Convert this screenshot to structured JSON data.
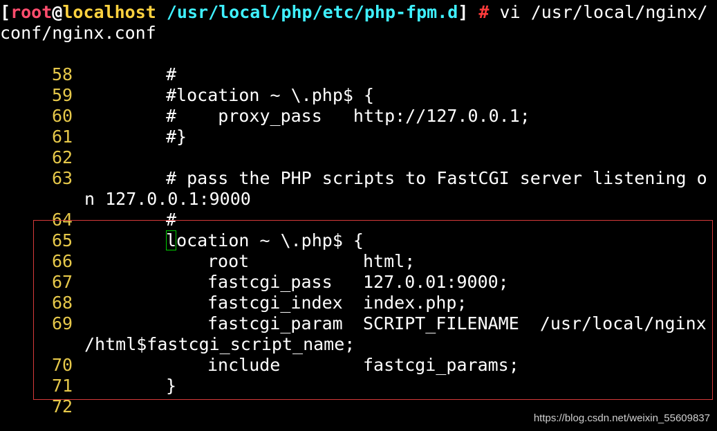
{
  "prompt": {
    "open_bracket": "[",
    "user": "root",
    "at": "@",
    "host": "localhost",
    "cwd": " /usr/local/php/etc/php-fpm.d",
    "close_bracket": "]",
    "hash": " #",
    "command_part1": " vi /usr/local/nginx/",
    "command_part2": "conf/nginx.conf"
  },
  "lines": [
    {
      "num": "58",
      "text": "#"
    },
    {
      "num": "59",
      "text": "#location ~ \\.php$ {"
    },
    {
      "num": "60",
      "text": "#    proxy_pass   http://127.0.0.1;"
    },
    {
      "num": "61",
      "text": "#}"
    },
    {
      "num": "62",
      "text": ""
    },
    {
      "num": "63",
      "text": "# pass the PHP scripts to FastCGI server listening o",
      "wrap": "n 127.0.0.1:9000"
    },
    {
      "num": "64",
      "text": "#"
    },
    {
      "num": "65",
      "cursor_char": "l",
      "text": "ocation ~ \\.php$ {"
    },
    {
      "num": "66",
      "key": "root",
      "value": "html;"
    },
    {
      "num": "67",
      "key": "fastcgi_pass",
      "value": "127.0.01:9000;"
    },
    {
      "num": "68",
      "key": "fastcgi_index",
      "value": "index.php;"
    },
    {
      "num": "69",
      "key": "fastcgi_param",
      "value": "SCRIPT_FILENAME  /usr/local/nginx",
      "wrap": "/html$fastcgi_script_name;"
    },
    {
      "num": "70",
      "key": "include",
      "value": "fastcgi_params;"
    },
    {
      "num": "71",
      "text": "}"
    },
    {
      "num": "72",
      "text": ""
    }
  ],
  "watermark": "https://blog.csdn.net/weixin_55609837",
  "colors": {
    "background": "#000000",
    "line_number": "#e6c84a",
    "user": "#ff4d6d",
    "host": "#ffd23f",
    "cwd": "#3ff0ff",
    "hash": "#ff3b3b",
    "highlight_box": "#d63a3a",
    "cursor": "#00d000"
  }
}
